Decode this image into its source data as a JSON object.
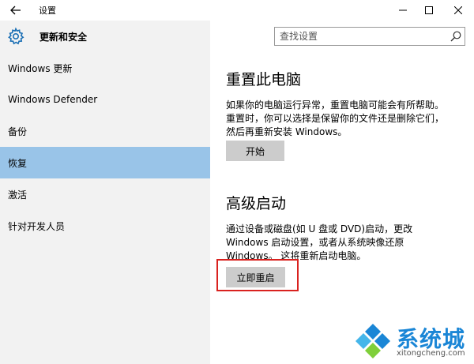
{
  "window": {
    "title": "设置"
  },
  "sidebar": {
    "header_title": "更新和安全",
    "items": [
      {
        "label": "Windows 更新"
      },
      {
        "label": "Windows Defender"
      },
      {
        "label": "备份"
      },
      {
        "label": "恢复",
        "selected": true
      },
      {
        "label": "激活"
      },
      {
        "label": "针对开发人员"
      }
    ]
  },
  "search": {
    "placeholder": "查找设置"
  },
  "reset": {
    "title": "重置此电脑",
    "lines": [
      "如果你的电脑运行异常，重置电脑可能会有所帮助。",
      "重置时，你可以选择是保留你的文件还是删除它们，",
      "然后再重新安装 Windows。"
    ],
    "button": "开始"
  },
  "advanced": {
    "title": "高级启动",
    "lines": [
      "通过设备或磁盘(如 U 盘或 DVD)启动，更改",
      "Windows 启动设置，或者从系统映像还原",
      "Windows。 这将重新启动电脑。"
    ],
    "button": "立即重启"
  },
  "watermark": {
    "name": "系统城",
    "url": "xitongcheng.com"
  },
  "colors": {
    "selected_nav": "#99c4e8",
    "highlight_border": "#d9221f",
    "watermark_blue": "#1a86d6"
  }
}
